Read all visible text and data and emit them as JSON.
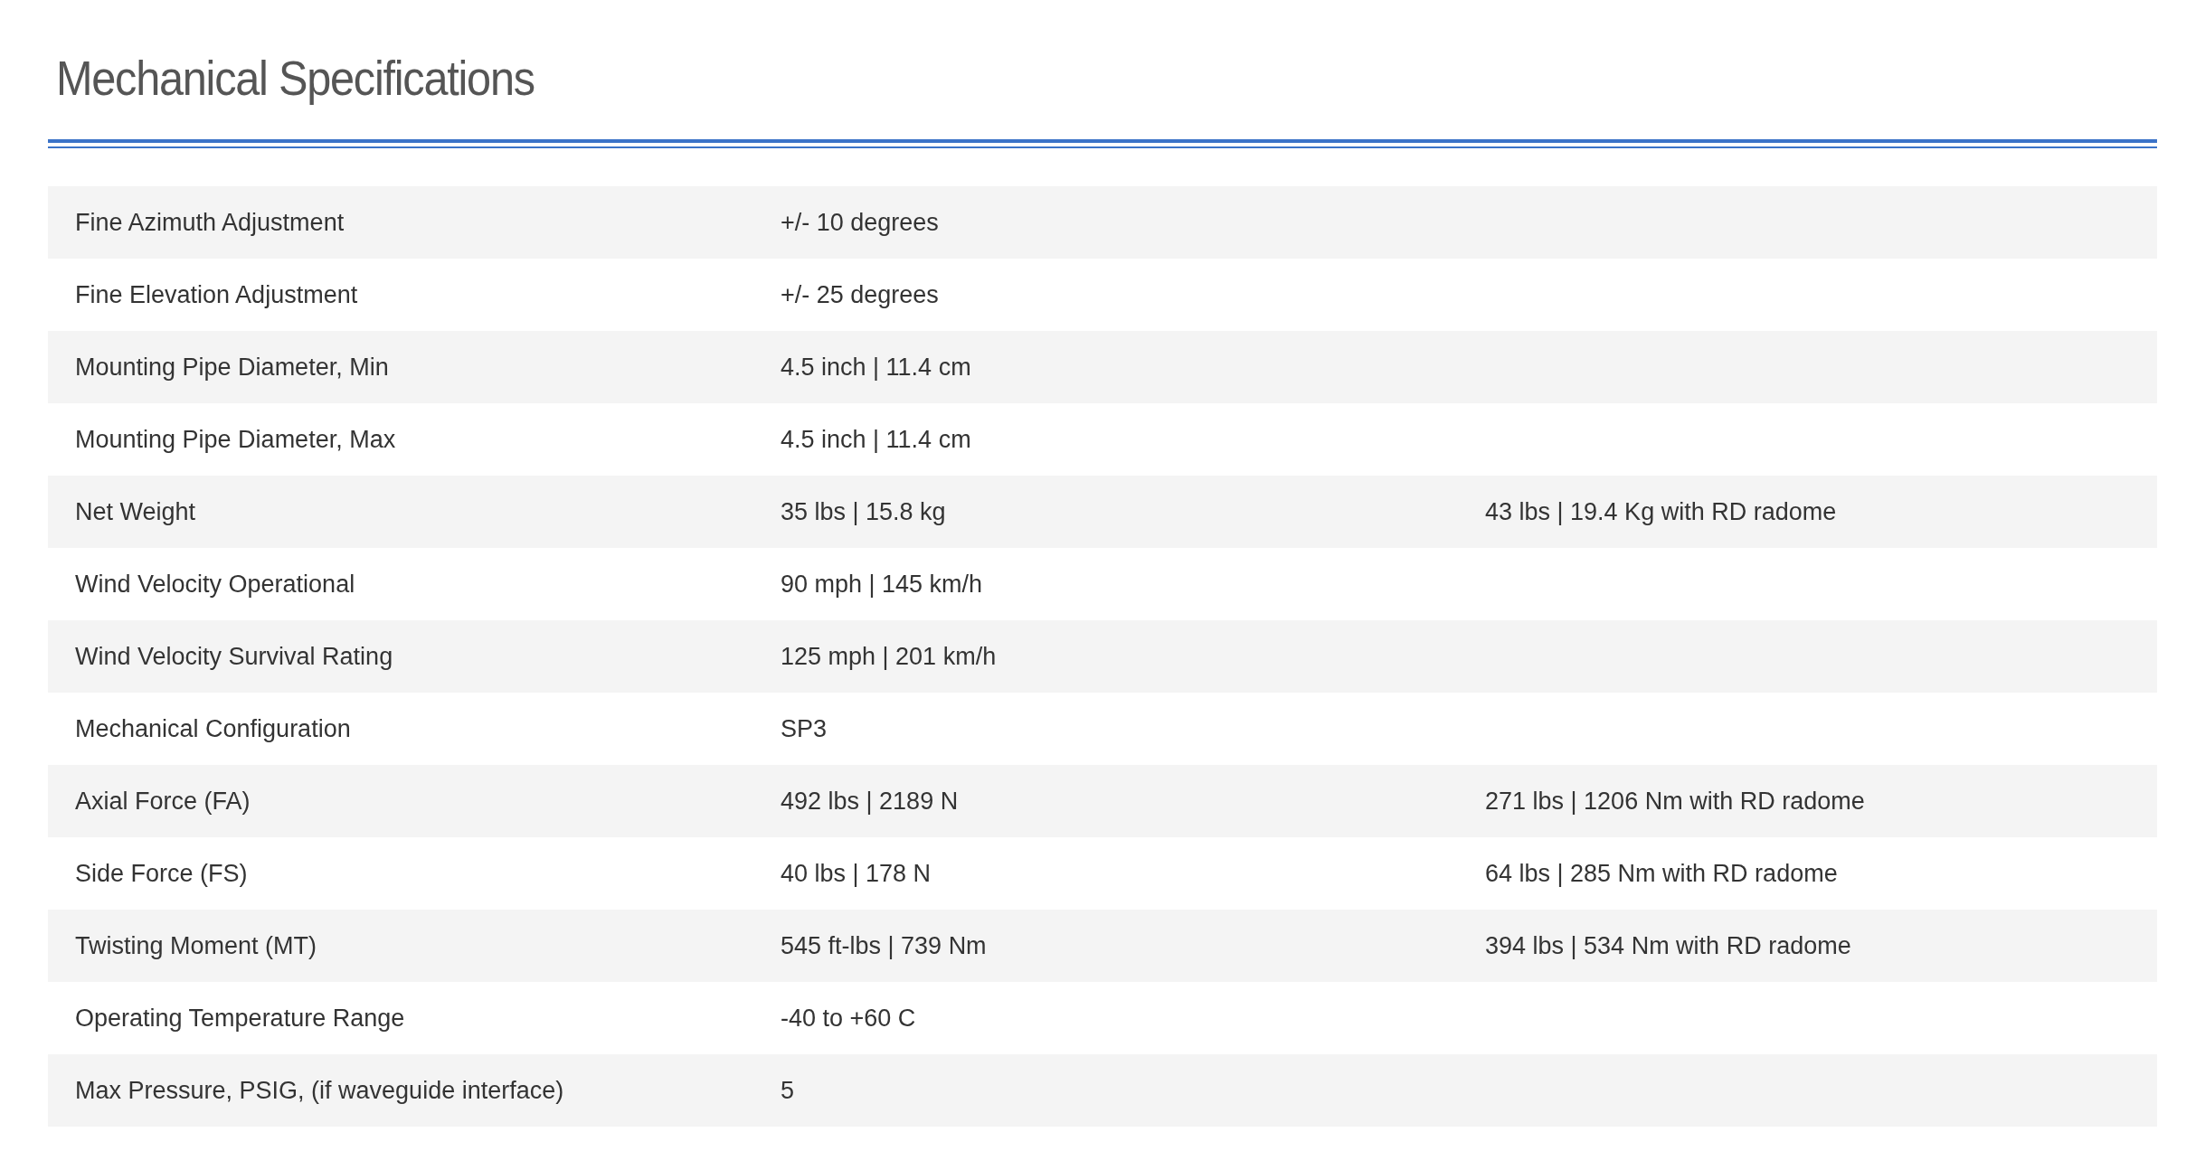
{
  "title": "Mechanical Specifications",
  "rows": [
    {
      "label": "Fine Azimuth Adjustment",
      "value": "+/- 10 degrees"
    },
    {
      "label": "Fine Elevation Adjustment",
      "value": "+/- 25 degrees"
    },
    {
      "label": "Mounting Pipe Diameter, Min",
      "value": "4.5 inch | 11.4 cm"
    },
    {
      "label": "Mounting Pipe Diameter, Max",
      "value": "4.5 inch | 11.4 cm"
    },
    {
      "label": "Net Weight",
      "value": "35 lbs | 15.8 kg",
      "note": "43 lbs | 19.4 Kg with RD radome"
    },
    {
      "label": "Wind Velocity Operational",
      "value": "90 mph | 145 km/h"
    },
    {
      "label": "Wind Velocity Survival Rating",
      "value": "125 mph | 201 km/h"
    },
    {
      "label": "Mechanical Configuration",
      "value": "SP3"
    },
    {
      "label": "Axial Force (FA)",
      "value": "492 lbs | 2189 N",
      "note": "271 lbs | 1206 Nm with RD radome"
    },
    {
      "label": "Side Force (FS)",
      "value": "40 lbs | 178 N",
      "note": "64 lbs | 285 Nm with RD radome"
    },
    {
      "label": "Twisting Moment (MT)",
      "value": "545 ft-lbs | 739 Nm",
      "note": "394 lbs | 534 Nm with RD radome"
    },
    {
      "label": "Operating Temperature Range",
      "value": "-40 to +60 C"
    },
    {
      "label": "Max Pressure, PSIG, (if waveguide interface)",
      "value": "5"
    }
  ]
}
